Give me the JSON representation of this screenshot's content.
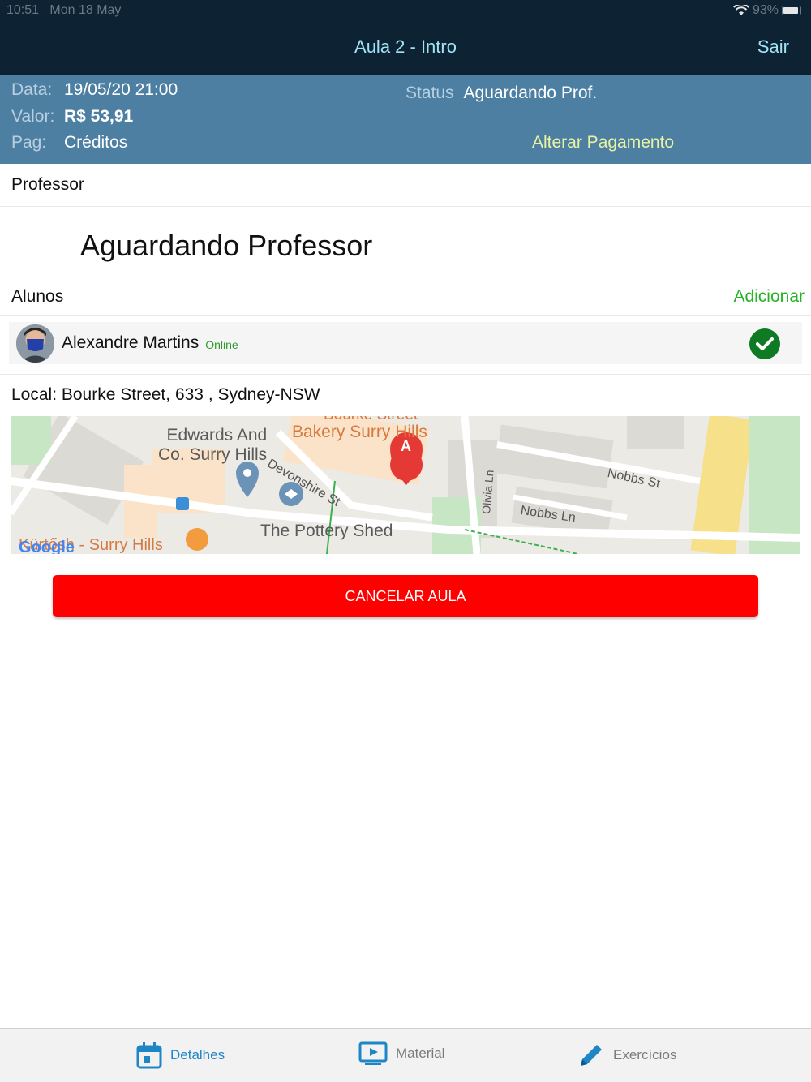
{
  "status_bar": {
    "time": "10:51",
    "date": "Mon 18 May",
    "battery": "93%"
  },
  "nav": {
    "title": "Aula 2 - Intro",
    "right_button": "Sair"
  },
  "info": {
    "data_label": "Data:",
    "data_value": "19/05/20 21:00",
    "valor_label": "Valor:",
    "valor_value": "R$ 53,91",
    "pag_label": "Pag:",
    "pag_value": "Créditos",
    "status_label": "Status",
    "status_value": "Aguardando Prof.",
    "alterar_link": "Alterar Pagamento"
  },
  "professor": {
    "section_label": "Professor",
    "title": "Aguardando Professor"
  },
  "alunos": {
    "section_label": "Alunos",
    "add_button": "Adicionar",
    "students": [
      {
        "name": "Alexandre Martins",
        "status": "Online"
      }
    ]
  },
  "local": {
    "text": "Local: Bourke Street, 633 , Sydney-NSW"
  },
  "map": {
    "labels": {
      "edwards_1": "Edwards And",
      "edwards_2": "Co. Surry Hills",
      "bakery_top": "Bourke Street",
      "bakery": "Bakery Surry Hills",
      "devonshire": "Devonshire St",
      "pottery": "The Pottery Shed",
      "kurtosh": "Kürtősh - Surry Hills",
      "nobbs_st": "Nobbs St",
      "nobbs_ln": "Nobbs Ln",
      "olivia": "Olivia Ln",
      "marker": "A",
      "google": "Google"
    }
  },
  "actions": {
    "cancel": "CANCELAR AULA"
  },
  "tabs": {
    "detalhes": "Detalhes",
    "material": "Material",
    "exercicios": "Exercícios"
  },
  "colors": {
    "nav_bg": "#0d2233",
    "nav_text": "#9fe3f5",
    "info_bg": "#4d7fa3",
    "accent_green": "#27b227",
    "cancel_red": "#fe0000",
    "tab_active": "#1f86c6"
  }
}
